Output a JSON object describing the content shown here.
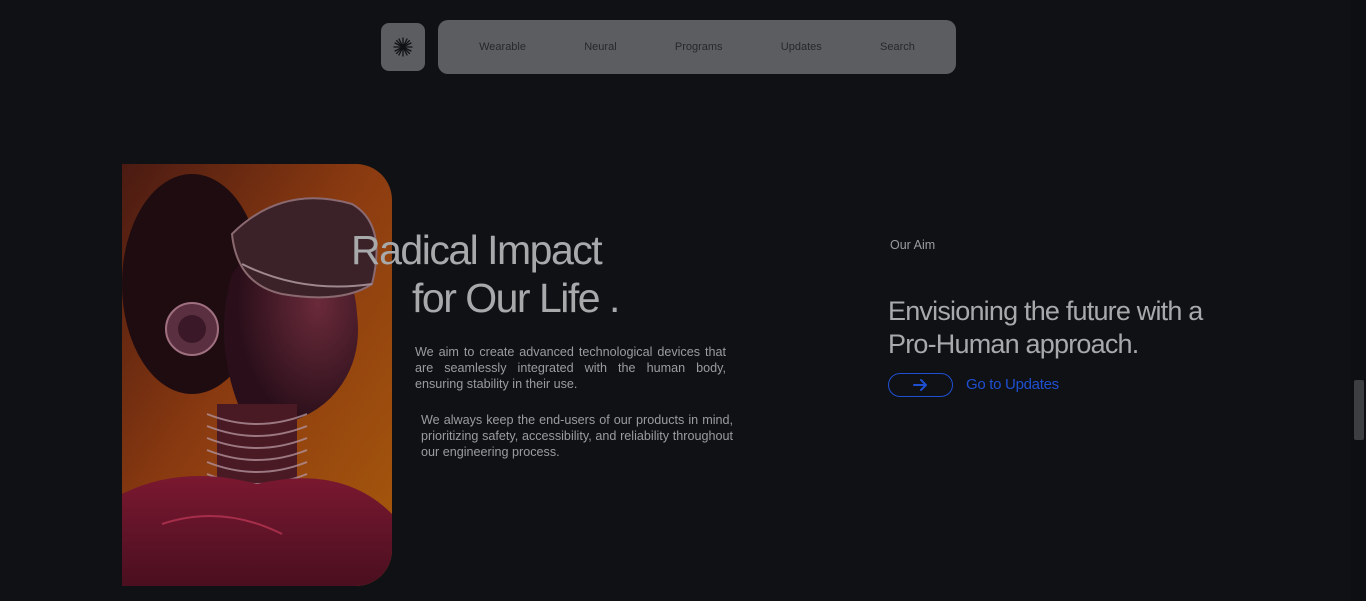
{
  "nav": {
    "logo_icon": "asterisk-logo-icon",
    "items": [
      {
        "label": "Wearable"
      },
      {
        "label": "Neural"
      },
      {
        "label": "Programs"
      },
      {
        "label": "Updates"
      },
      {
        "label": "Search"
      }
    ]
  },
  "hero": {
    "image": "person-with-vr-headset-portrait",
    "title_line1": "Radical Impact",
    "title_line2": "for Our Life .",
    "paragraph1": "We aim to create advanced technological devices that are seamlessly integrated with the human body, ensuring stability in their use.",
    "paragraph2": "We always keep the end-users of our products in mind, prioritizing safety, accessibility, and reliability throughout our engineering process."
  },
  "aim": {
    "eyebrow": "Our Aim",
    "headline": "Envisioning the future with a Pro-Human approach.",
    "button_icon": "arrow-right-icon",
    "link_label": "Go to Updates"
  },
  "colors": {
    "background": "#0f1115",
    "nav_bg": "#5b5d60",
    "accent_blue": "#1f4fd1",
    "text": "#a7a9ab"
  }
}
